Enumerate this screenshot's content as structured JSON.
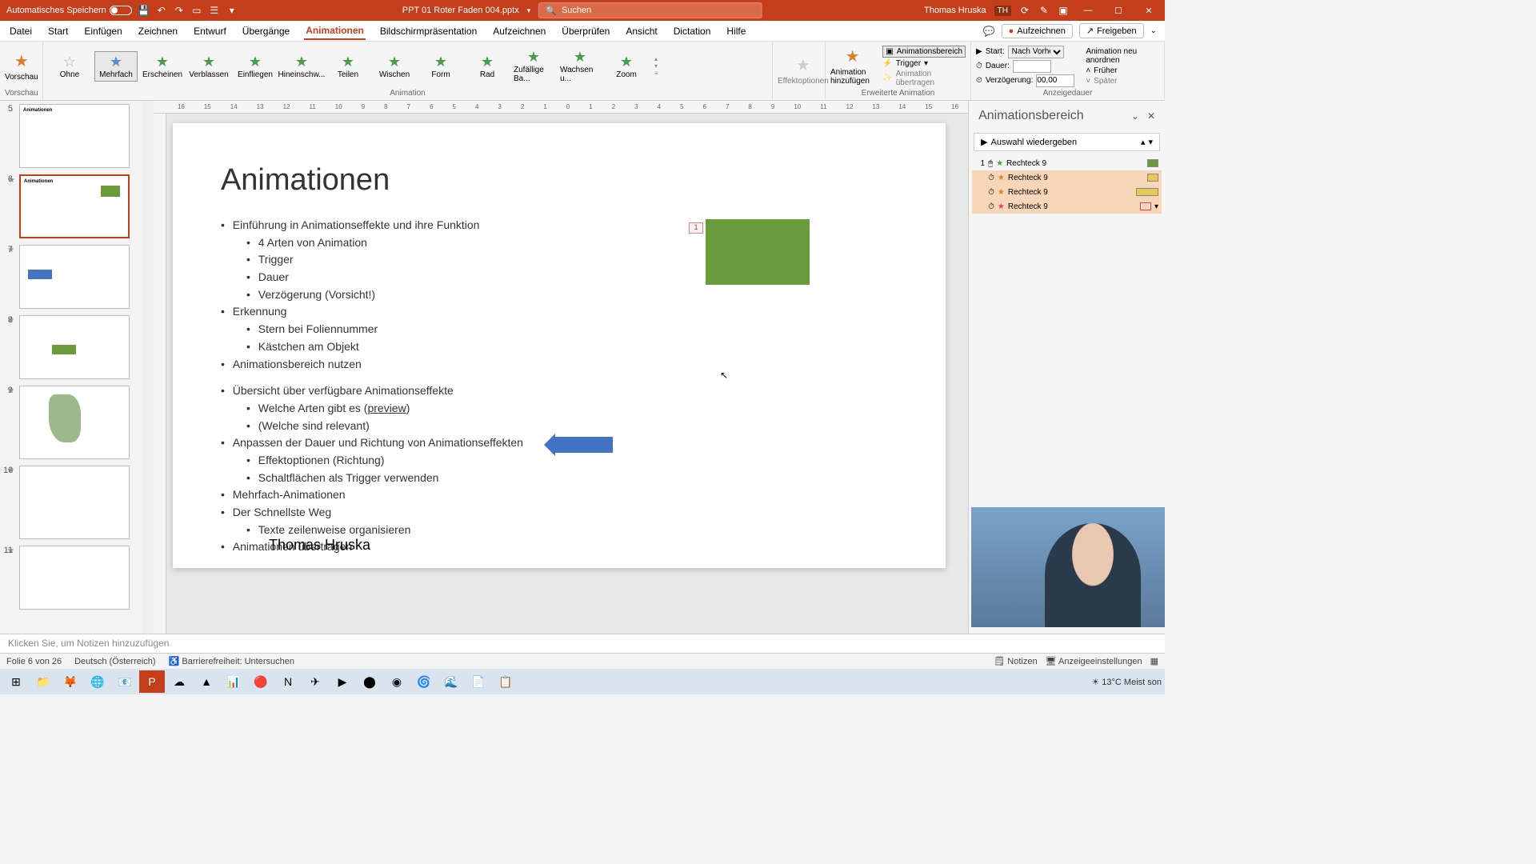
{
  "titlebar": {
    "autosave": "Automatisches Speichern",
    "filename": "PPT 01 Roter Faden 004.pptx",
    "search_placeholder": "Suchen",
    "user": "Thomas Hruska",
    "user_initials": "TH"
  },
  "menu": {
    "datei": "Datei",
    "start": "Start",
    "einfugen": "Einfügen",
    "zeichnen": "Zeichnen",
    "entwurf": "Entwurf",
    "ubergange": "Übergänge",
    "animationen": "Animationen",
    "bildschirm": "Bildschirmpräsentation",
    "aufzeichnen": "Aufzeichnen",
    "uberprufen": "Überprüfen",
    "ansicht": "Ansicht",
    "dictation": "Dictation",
    "hilfe": "Hilfe",
    "btn_aufzeichnen": "Aufzeichnen",
    "btn_freigeben": "Freigeben"
  },
  "ribbon": {
    "vorschau": "Vorschau",
    "anims": {
      "ohne": "Ohne",
      "mehrfach": "Mehrfach",
      "erscheinen": "Erscheinen",
      "verblassen": "Verblassen",
      "einfliegen": "Einfliegen",
      "hinein": "Hineinschw...",
      "teilen": "Teilen",
      "wischen": "Wischen",
      "form": "Form",
      "rad": "Rad",
      "zufall": "Zufällige Ba...",
      "wachsen": "Wachsen u...",
      "zoom": "Zoom"
    },
    "group_animation": "Animation",
    "effektoptionen": "Effektoptionen",
    "hinzufugen": "Animation hinzufügen",
    "animationsbereich": "Animationsbereich",
    "trigger": "Trigger",
    "ubertragen": "Animation übertragen",
    "group_erweitert": "Erweiterte Animation",
    "start": "Start:",
    "start_value": "Nach Vorher...",
    "dauer": "Dauer:",
    "dauer_value": "",
    "verzogerung": "Verzögerung:",
    "verzogerung_value": "00,00",
    "neuanordnen": "Animation neu anordnen",
    "fruher": "Früher",
    "spater": "Später",
    "group_dauer": "Anzeigedauer"
  },
  "thumbs": [
    {
      "n": "5",
      "title": "Animationen"
    },
    {
      "n": "6",
      "title": "Animationen",
      "selected": true
    },
    {
      "n": "7"
    },
    {
      "n": "8"
    },
    {
      "n": "9"
    },
    {
      "n": "10"
    },
    {
      "n": "11"
    }
  ],
  "slide": {
    "title": "Animationen",
    "b1": "Einführung in Animationseffekte und ihre Funktion",
    "b1a": "4 Arten von Animation",
    "b1b": "Trigger",
    "b1c": "Dauer",
    "b1d": "Verzögerung (Vorsicht!)",
    "b2": "Erkennung",
    "b2a": "Stern bei Foliennummer",
    "b2b": "Kästchen am Objekt",
    "b3": "Animationsbereich nutzen",
    "b4": "Übersicht über verfügbare Animationseffekte",
    "b4a_pre": "Welche Arten gibt es (",
    "b4a_link": "preview",
    "b4a_post": ")",
    "b4b": "(Welche sind relevant)",
    "b5": "Anpassen der Dauer und Richtung von Animationseffekten",
    "b5a": "Effektoptionen (Richtung)",
    "b5b": "Schaltflächen als Trigger verwenden",
    "b6": "Mehrfach-Animationen",
    "b7": "Der Schnellste Weg",
    "b7a": "Texte zeilenweise organisieren",
    "b8": "Animationen übertragen",
    "author": "Thomas Hruska",
    "tag": "1"
  },
  "pane": {
    "title": "Animationsbereich",
    "play": "Auswahl wiedergeben",
    "items": [
      {
        "num": "1",
        "name": "Rechteck 9",
        "color": "#6a9c3e"
      },
      {
        "num": "",
        "name": "Rechteck 9",
        "color": "#e8c858",
        "sel": true
      },
      {
        "num": "",
        "name": "Rechteck 9",
        "color": "#e8c858",
        "sel": true,
        "wide": true
      },
      {
        "num": "",
        "name": "Rechteck 9",
        "color": "#d46",
        "sel": true
      }
    ]
  },
  "notes": "Klicken Sie, um Notizen hinzuzufügen",
  "status": {
    "folie": "Folie 6 von 26",
    "lang": "Deutsch (Österreich)",
    "access": "Barrierefreiheit: Untersuchen",
    "notizen": "Notizen",
    "anzeige": "Anzeigeeinstellungen"
  },
  "taskbar": {
    "temp": "13°C",
    "weather": "Meist son"
  }
}
